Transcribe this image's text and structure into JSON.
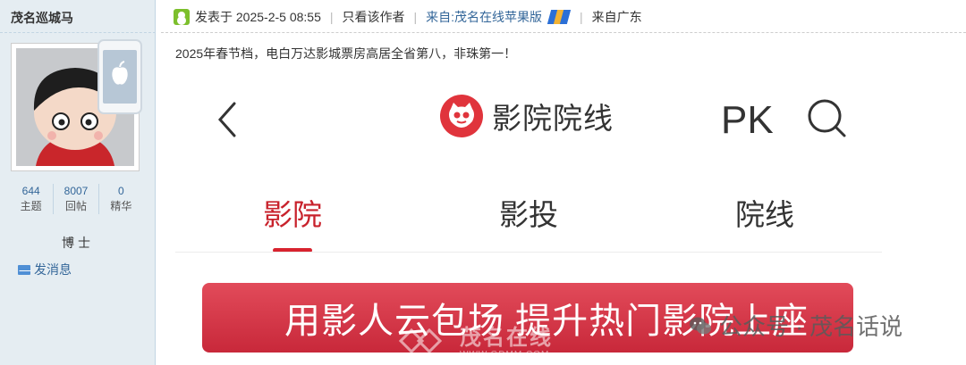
{
  "author": {
    "name": "茂名巡城马",
    "stats": [
      {
        "value": "644",
        "label": "主题"
      },
      {
        "value": "8007",
        "label": "回帖"
      },
      {
        "value": "0",
        "label": "精华"
      }
    ],
    "rank": "博士",
    "send_message_label": "发消息"
  },
  "post": {
    "posted_at": "发表于 2025-2-5 08:55",
    "only_author_label": "只看该作者",
    "source_app": "来自:茂名在线苹果版",
    "location": "来自广东",
    "title": "2025年春节档，电白万达影城票房高居全省第八，非珠第一！"
  },
  "app_screenshot": {
    "brand_name": "影院院线",
    "pk_label": "PK",
    "tabs": [
      {
        "label": "影院",
        "active": true
      },
      {
        "label": "影投",
        "active": false
      },
      {
        "label": "院线",
        "active": false
      }
    ],
    "banner_text": "用影人云包场 提升热门影院上座",
    "accent_color": "#d8232f"
  },
  "watermarks": {
    "public_account": "公众号 · 茂名话说",
    "site_name": "茂名在线",
    "site_url": "WWW.GDMM.COM"
  },
  "icons": [
    "user-online-icon",
    "apple-phone-icon",
    "mail-icon",
    "m-app-logo",
    "back-chevron-icon",
    "maoyan-cat-logo",
    "search-icon",
    "wechat-icon"
  ]
}
